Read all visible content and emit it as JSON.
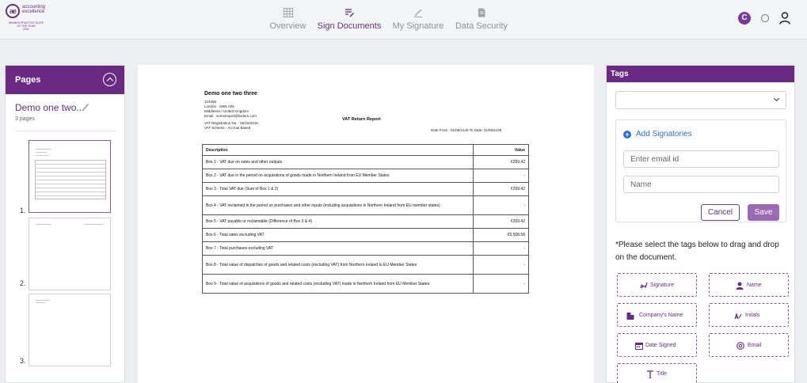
{
  "header": {
    "logo": {
      "mark": "ae",
      "line1": "accounting",
      "line2": "excellence",
      "sub1": "Winner Practice Suite",
      "sub2": "of the year",
      "sub3": "2021"
    },
    "nav": [
      {
        "label": "Overview",
        "icon": "grid-icon",
        "active": false
      },
      {
        "label": "Sign Documents",
        "icon": "sign-doc-icon",
        "active": true
      },
      {
        "label": "My Signature",
        "icon": "pen-icon",
        "active": false
      },
      {
        "label": "Data Security",
        "icon": "file-lock-icon",
        "active": false
      }
    ],
    "brand_badge": "C"
  },
  "left_panel": {
    "title": "Pages",
    "doc_name": "Demo one two...",
    "page_count": "3 pages",
    "thumbnails": [
      "1.",
      "2.",
      "3."
    ]
  },
  "document": {
    "company": "Demo one two three",
    "address": [
      "123456",
      "London - SW5 A06",
      "Middlesex / United Kingdom",
      "Email : someinquiri@bsdum.com",
      "VAT Registration No. : 564154215",
      "VAT Scheme : Accrual Based"
    ],
    "report_title": "VAT Return Report",
    "date_range": "Date From : 01/05/2149 To Date: 31/05/2149",
    "table": {
      "headers": [
        "Description",
        "Value"
      ],
      "rows": [
        [
          "Box 1 - VAT due on sales and other outputs",
          "€269.42"
        ],
        [
          "Box 2 - VAT due in the period on acquisitions of goods made in Northern Ireland from EU Member States",
          "-"
        ],
        [
          "Box 3 - Total VAT due (Sum of Box 1 & 2)",
          "€269.42"
        ],
        [
          "Box 4 - VAT reclaimed in the period on purchases and other inputs (including acquisitions in Northern Ireland from EU member states)",
          "-"
        ],
        [
          "Box 5 - VAT payable or reclaimable (Difference of Box 3 & 4)",
          "€269.42"
        ],
        [
          "Box 6 - Total sales excluding VAT",
          "€5,508.58"
        ],
        [
          "Box 7 - Total purchases excluding VAT",
          "-"
        ],
        [
          "Box 8 - Total value of dispatches of goods and related costs (excluding VAT) from Northern Ireland to EU Member States",
          "-"
        ],
        [
          "Box 9 - Total value of acquisitions of goods and related costs (excluding VAT) made in Northern Ireland from EU Member States",
          "-"
        ]
      ]
    }
  },
  "right_panel": {
    "title": "Tags",
    "add_signatories": "Add Signatories",
    "email_placeholder": "Enter email id",
    "name_placeholder": "Name",
    "cancel_label": "Cancel",
    "save_label": "Save",
    "instructions": "*Please select the tags below to drag and drop on the document.",
    "tags": [
      {
        "label": "Signature",
        "icon": "signature-icon"
      },
      {
        "label": "Name",
        "icon": "person-icon"
      },
      {
        "label": "Company's Name",
        "icon": "building-icon"
      },
      {
        "label": "Initals",
        "icon": "initials-icon"
      },
      {
        "label": "Date Signed",
        "icon": "calendar-icon"
      },
      {
        "label": "Email",
        "icon": "at-icon"
      },
      {
        "label": "Title",
        "icon": "title-icon"
      }
    ]
  },
  "colors": {
    "brand": "#6a2a84",
    "link": "#2a6fd4",
    "save": "#9c6ab3"
  }
}
